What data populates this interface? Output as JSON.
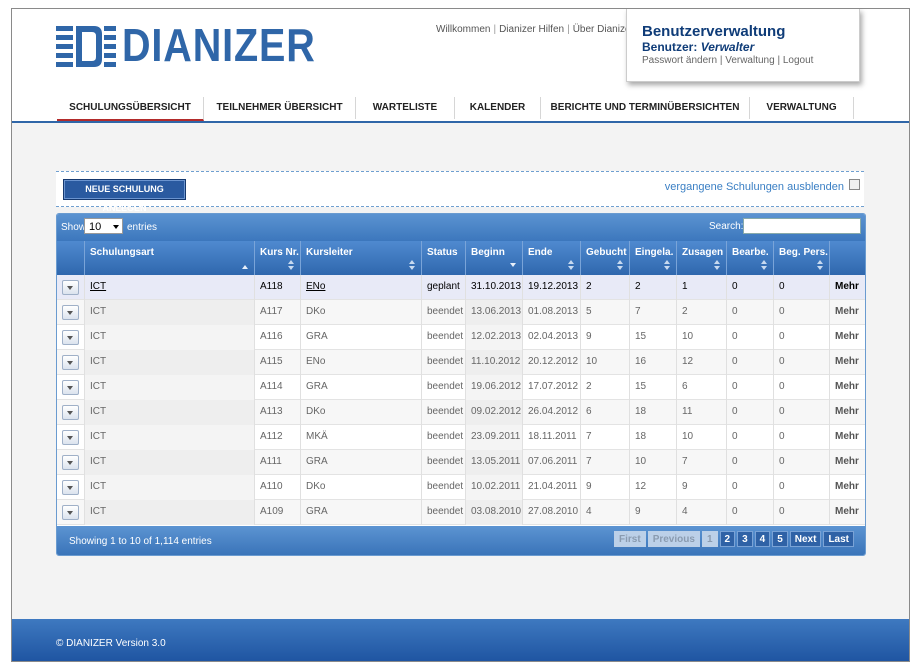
{
  "app": {
    "logo_text": "DIANIZER"
  },
  "top_links": [
    "Willkommen",
    "Dianizer Hilfen",
    "Über Dianizer"
  ],
  "userbox": {
    "title": "Benutzerverwaltung",
    "user_label": "Benutzer:",
    "user_name": "Verwalter",
    "links": [
      "Passwort ändern",
      "Verwaltung",
      "Logout"
    ]
  },
  "nav": {
    "tabs": [
      {
        "label": "SCHULUNGSÜBERSICHT",
        "active": true
      },
      {
        "label": "TEILNEHMER ÜBERSICHT",
        "active": false
      },
      {
        "label": "WARTELISTE",
        "active": false
      },
      {
        "label": "KALENDER",
        "active": false
      },
      {
        "label": "BERICHTE UND TERMINÜBERSICHTEN",
        "active": false
      },
      {
        "label": "VERWALTUNG",
        "active": false
      }
    ]
  },
  "toolbar": {
    "new_button": "NEUE SCHULUNG ANLEGEN",
    "hide_past_label": "vergangene Schulungen ausblenden"
  },
  "table": {
    "show_label": "Show",
    "page_size": "10",
    "entries_label": "entries",
    "search_label": "Search:",
    "columns": [
      "Schulungsart",
      "Kurs Nr.",
      "Kursleiter",
      "Status",
      "Beginn",
      "Ende",
      "Gebucht",
      "Eingela.",
      "Zusagen",
      "Bearbe.",
      "Beg. Pers."
    ],
    "rows": [
      {
        "art": "ICT",
        "nr": "A118",
        "leiter": "ENo",
        "status": "geplant",
        "beginn": "31.10.2013",
        "ende": "19.12.2013",
        "gebucht": "2",
        "eingela": "2",
        "zusagen": "1",
        "bearbe": "0",
        "beg": "0",
        "more": "Mehr"
      },
      {
        "art": "ICT",
        "nr": "A117",
        "leiter": "DKo",
        "status": "beendet",
        "beginn": "13.06.2013",
        "ende": "01.08.2013",
        "gebucht": "5",
        "eingela": "7",
        "zusagen": "2",
        "bearbe": "0",
        "beg": "0",
        "more": "Mehr"
      },
      {
        "art": "ICT",
        "nr": "A116",
        "leiter": "GRA",
        "status": "beendet",
        "beginn": "12.02.2013",
        "ende": "02.04.2013",
        "gebucht": "9",
        "eingela": "15",
        "zusagen": "10",
        "bearbe": "0",
        "beg": "0",
        "more": "Mehr"
      },
      {
        "art": "ICT",
        "nr": "A115",
        "leiter": "ENo",
        "status": "beendet",
        "beginn": "11.10.2012",
        "ende": "20.12.2012",
        "gebucht": "10",
        "eingela": "16",
        "zusagen": "12",
        "bearbe": "0",
        "beg": "0",
        "more": "Mehr"
      },
      {
        "art": "ICT",
        "nr": "A114",
        "leiter": "GRA",
        "status": "beendet",
        "beginn": "19.06.2012",
        "ende": "17.07.2012",
        "gebucht": "2",
        "eingela": "15",
        "zusagen": "6",
        "bearbe": "0",
        "beg": "0",
        "more": "Mehr"
      },
      {
        "art": "ICT",
        "nr": "A113",
        "leiter": "DKo",
        "status": "beendet",
        "beginn": "09.02.2012",
        "ende": "26.04.2012",
        "gebucht": "6",
        "eingela": "18",
        "zusagen": "11",
        "bearbe": "0",
        "beg": "0",
        "more": "Mehr"
      },
      {
        "art": "ICT",
        "nr": "A112",
        "leiter": "MKÄ",
        "status": "beendet",
        "beginn": "23.09.2011",
        "ende": "18.11.2011",
        "gebucht": "7",
        "eingela": "18",
        "zusagen": "10",
        "bearbe": "0",
        "beg": "0",
        "more": "Mehr"
      },
      {
        "art": "ICT",
        "nr": "A111",
        "leiter": "GRA",
        "status": "beendet",
        "beginn": "13.05.2011",
        "ende": "07.06.2011",
        "gebucht": "7",
        "eingela": "10",
        "zusagen": "7",
        "bearbe": "0",
        "beg": "0",
        "more": "Mehr"
      },
      {
        "art": "ICT",
        "nr": "A110",
        "leiter": "DKo",
        "status": "beendet",
        "beginn": "10.02.2011",
        "ende": "21.04.2011",
        "gebucht": "9",
        "eingela": "12",
        "zusagen": "9",
        "bearbe": "0",
        "beg": "0",
        "more": "Mehr"
      },
      {
        "art": "ICT",
        "nr": "A109",
        "leiter": "GRA",
        "status": "beendet",
        "beginn": "03.08.2010",
        "ende": "27.08.2010",
        "gebucht": "4",
        "eingela": "9",
        "zusagen": "4",
        "bearbe": "0",
        "beg": "0",
        "more": "Mehr"
      }
    ],
    "info": "Showing 1 to 10 of 1,114 entries",
    "pager": [
      "First",
      "Previous",
      "1",
      "2",
      "3",
      "4",
      "5",
      "Next",
      "Last"
    ]
  },
  "footer": {
    "copyright": "© DIANIZER Version 3.0"
  },
  "colors": {
    "brand": "#2f66a8",
    "active_tab": "#b32b2b",
    "header_blue": "#3c77bd"
  }
}
